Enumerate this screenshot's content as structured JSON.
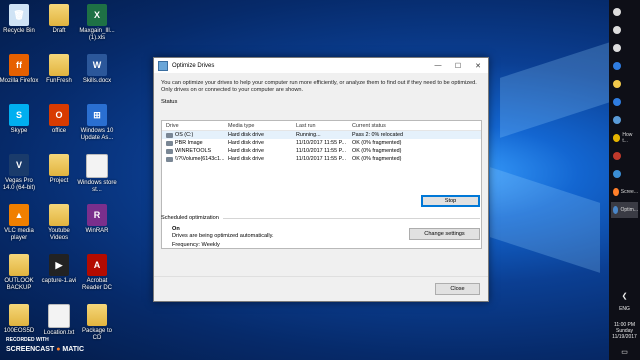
{
  "desktop_icons": [
    {
      "label": "Recycle Bin",
      "kind": "recycle"
    },
    {
      "label": "Draft",
      "kind": "folder"
    },
    {
      "label": "Maxgain_Ill... (1).xls",
      "kind": "excel"
    },
    {
      "label": "Mozilla Firefox",
      "kind": "firefox"
    },
    {
      "label": "FunFresh",
      "kind": "folder"
    },
    {
      "label": "Skills.docx",
      "kind": "word"
    },
    {
      "label": "Skype",
      "kind": "skype"
    },
    {
      "label": "office",
      "kind": "office"
    },
    {
      "label": "Windows 10 Update As...",
      "kind": "win"
    },
    {
      "label": "Vegas Pro 14.0 (64-bit)",
      "kind": "vegas"
    },
    {
      "label": "Project",
      "kind": "folder"
    },
    {
      "label": "Windows store st...",
      "kind": "doc"
    },
    {
      "label": "VLC media player",
      "kind": "vlc"
    },
    {
      "label": "Youtube Videos",
      "kind": "folder"
    },
    {
      "label": "WinRAR",
      "kind": "winrar"
    },
    {
      "label": "OUTLOOK BACKUP",
      "kind": "folder"
    },
    {
      "label": "capture-1.avi",
      "kind": "video"
    },
    {
      "label": "Acrobat Reader DC",
      "kind": "acrobat"
    },
    {
      "label": "100EOS5D",
      "kind": "folder"
    },
    {
      "label": "Location.txt",
      "kind": "doc"
    },
    {
      "label": "Package to CD",
      "kind": "folder"
    }
  ],
  "watermark": {
    "line1": "RECORDED WITH",
    "line2": "SCREENCAST",
    "line3": "MATIC"
  },
  "taskbar": {
    "items": [
      {
        "label": "",
        "icon": "power-icon"
      },
      {
        "label": "",
        "icon": "search-icon"
      },
      {
        "label": "",
        "icon": "task-view-icon"
      },
      {
        "label": "",
        "icon": "edge-icon"
      },
      {
        "label": "",
        "icon": "explorer-icon"
      },
      {
        "label": "",
        "icon": "store-icon"
      },
      {
        "label": "",
        "icon": "mail-icon"
      },
      {
        "label": "How t...",
        "icon": "chrome-icon"
      },
      {
        "label": "",
        "icon": "acrobat-icon"
      },
      {
        "label": "",
        "icon": "app-icon"
      },
      {
        "label": "Scree...",
        "icon": "screencast-icon"
      },
      {
        "label": "Optim...",
        "icon": "optimize-icon"
      }
    ],
    "lang": "ENG",
    "time": "11:00 PM",
    "day": "Sunday",
    "date": "11/19/2017"
  },
  "dialog": {
    "title": "Optimize Drives",
    "intro": "You can optimize your drives to help your computer run more efficiently, or analyze them to find out if they need to be optimized. Only drives on or connected to your computer are shown.",
    "status_label": "Status",
    "columns": [
      "Drive",
      "Media type",
      "Last run",
      "Current status"
    ],
    "drives": [
      {
        "drive": "OS (C:)",
        "media": "Hard disk drive",
        "last_run": "Running...",
        "status": "Pass 2: 0% relocated"
      },
      {
        "drive": "PBR Image",
        "media": "Hard disk drive",
        "last_run": "11/10/2017 11:55 P...",
        "status": "OK (0% fragmented)"
      },
      {
        "drive": "WINRETOOLS",
        "media": "Hard disk drive",
        "last_run": "11/10/2017 11:55 P...",
        "status": "OK (0% fragmented)"
      },
      {
        "drive": "\\\\?\\Volume{6143c1...",
        "media": "Hard disk drive",
        "last_run": "11/10/2017 11:55 P...",
        "status": "OK (0% fragmented)"
      }
    ],
    "stop_button": "Stop",
    "scheduled_label": "Scheduled optimization",
    "sched_state": "On",
    "sched_desc": "Drives are being optimized automatically.",
    "sched_freq": "Frequency: Weekly",
    "change_settings_button": "Change settings",
    "close_button": "Close"
  },
  "colors": {
    "accent": "#0078d7",
    "selection": "#e5f1fb",
    "taskbar": "#0e0f17"
  }
}
